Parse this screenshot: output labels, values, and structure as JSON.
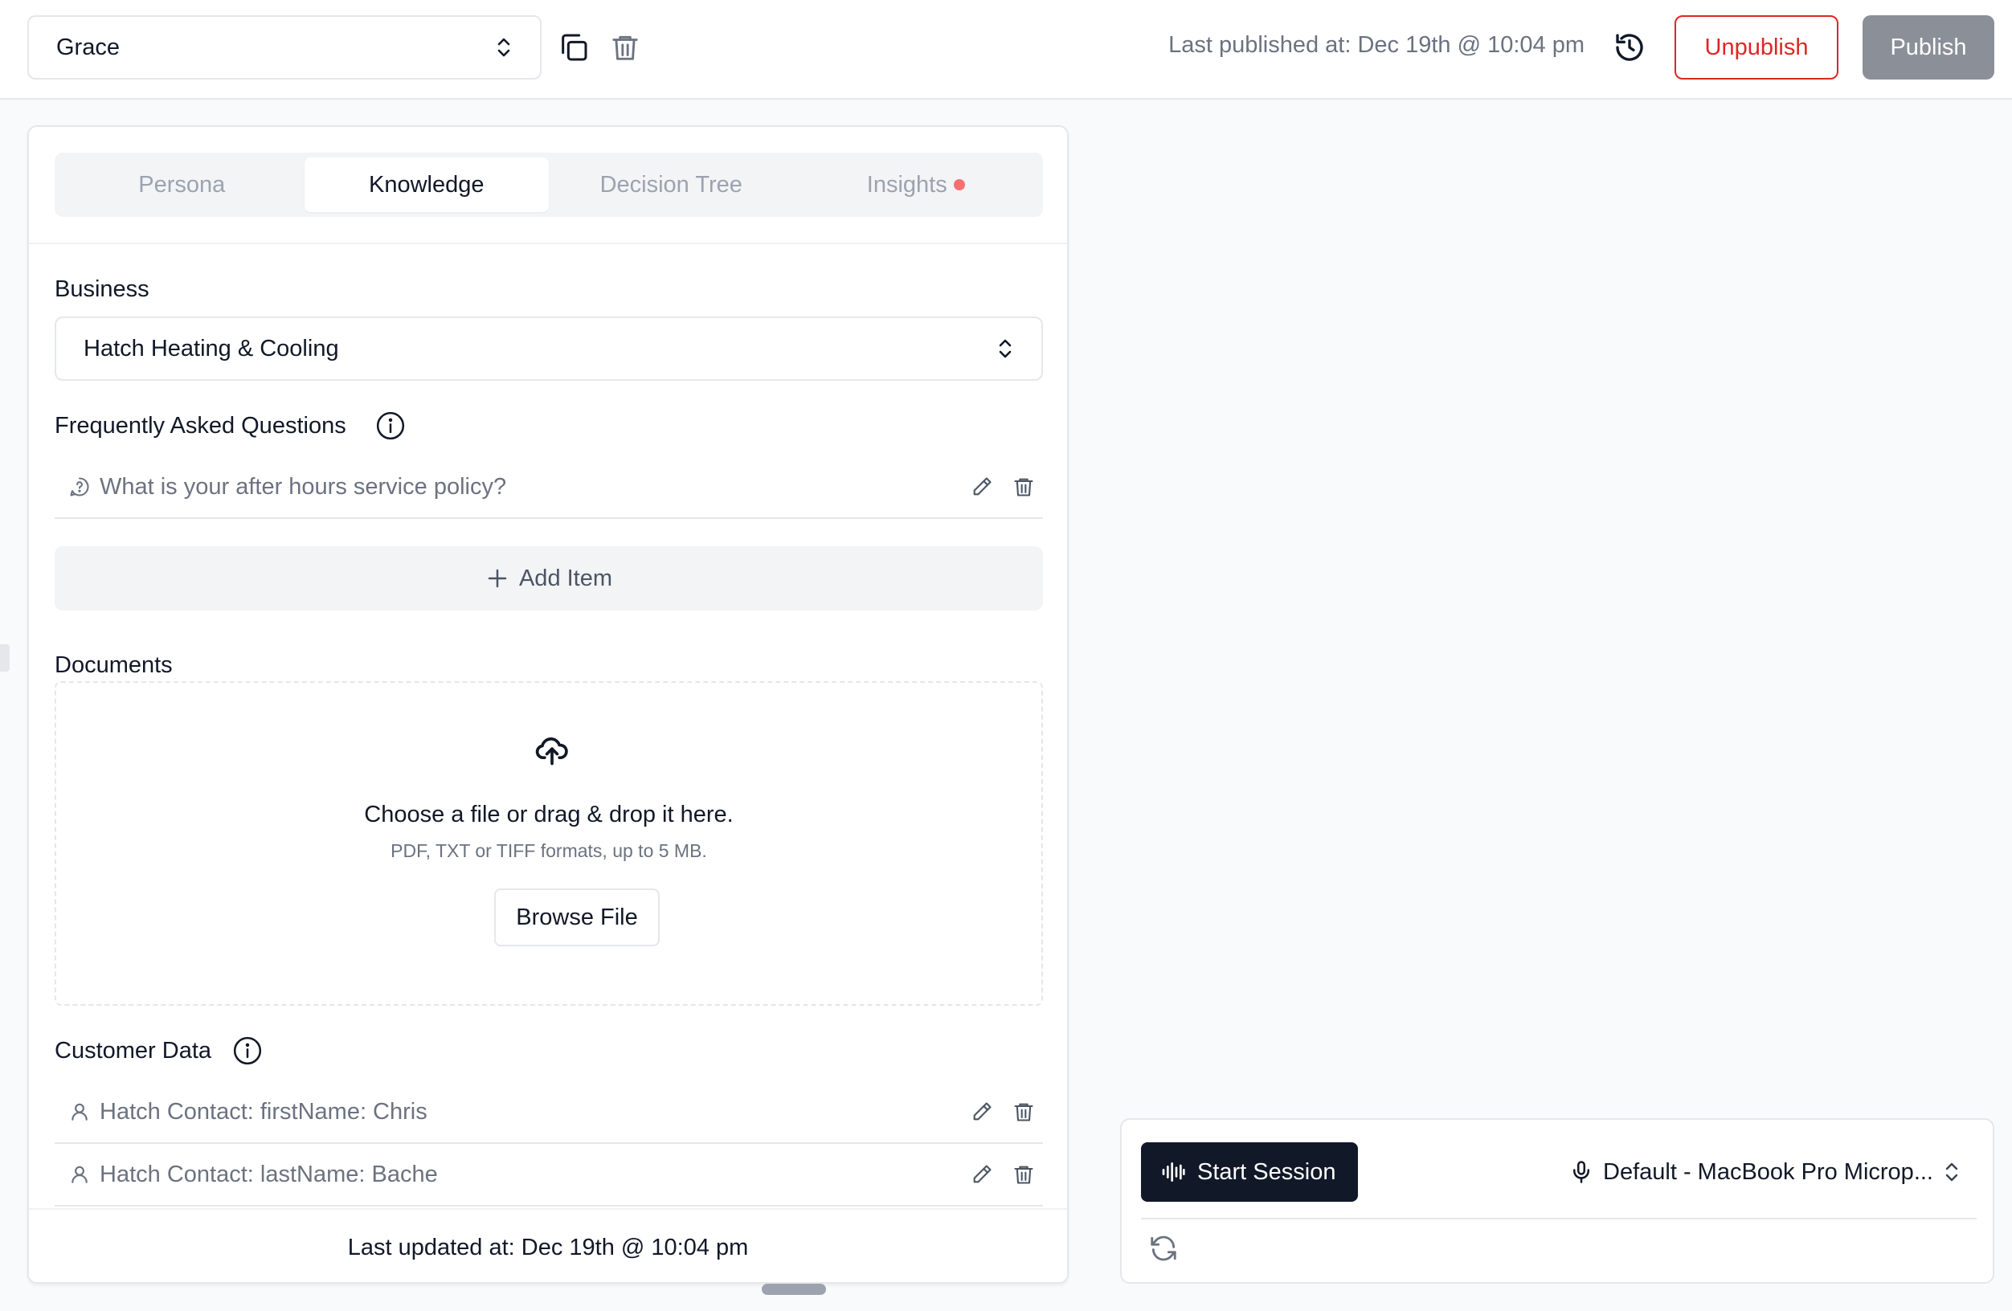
{
  "header": {
    "agent_select_value": "Grace",
    "last_published": "Last published at: Dec 19th @ 10:04 pm",
    "unpublish_label": "Unpublish",
    "publish_label": "Publish"
  },
  "tabs": [
    {
      "label": "Persona",
      "active": false
    },
    {
      "label": "Knowledge",
      "active": true
    },
    {
      "label": "Decision Tree",
      "active": false
    },
    {
      "label": "Insights",
      "active": false,
      "has_dot": true
    }
  ],
  "business": {
    "label": "Business",
    "value": "Hatch Heating & Cooling"
  },
  "faq": {
    "label": "Frequently Asked Questions",
    "items": [
      {
        "text": "What is your after hours service policy?"
      }
    ],
    "add_label": "Add Item"
  },
  "documents": {
    "label": "Documents",
    "title": "Choose a file or drag & drop it here.",
    "subtitle": "PDF, TXT or TIFF formats, up to 5 MB.",
    "browse_label": "Browse File"
  },
  "customer_data": {
    "label": "Customer Data",
    "items": [
      {
        "text": "Hatch Contact: firstName: Chris"
      },
      {
        "text": "Hatch Contact: lastName: Bache"
      }
    ]
  },
  "footer": {
    "last_updated": "Last updated at: Dec 19th @ 10:04 pm"
  },
  "session": {
    "start_label": "Start Session",
    "mic_label": "Default - MacBook Pro Microp..."
  },
  "colors": {
    "accent_dark": "#111827",
    "danger": "#dc2626",
    "publish_disabled": "#8b8f97",
    "notification_dot": "#f87171"
  },
  "icons": {
    "copy": "copy-icon",
    "trash": "trash-icon",
    "history": "history-icon",
    "chevrons": "chevron-up-down-icon",
    "info": "info-icon",
    "question": "question-circle-icon",
    "pencil": "pencil-icon",
    "plus": "plus-icon",
    "upload": "cloud-upload-icon",
    "user": "user-icon",
    "waveform": "audio-waveform-icon",
    "mic": "microphone-icon",
    "refresh": "refresh-icon"
  }
}
